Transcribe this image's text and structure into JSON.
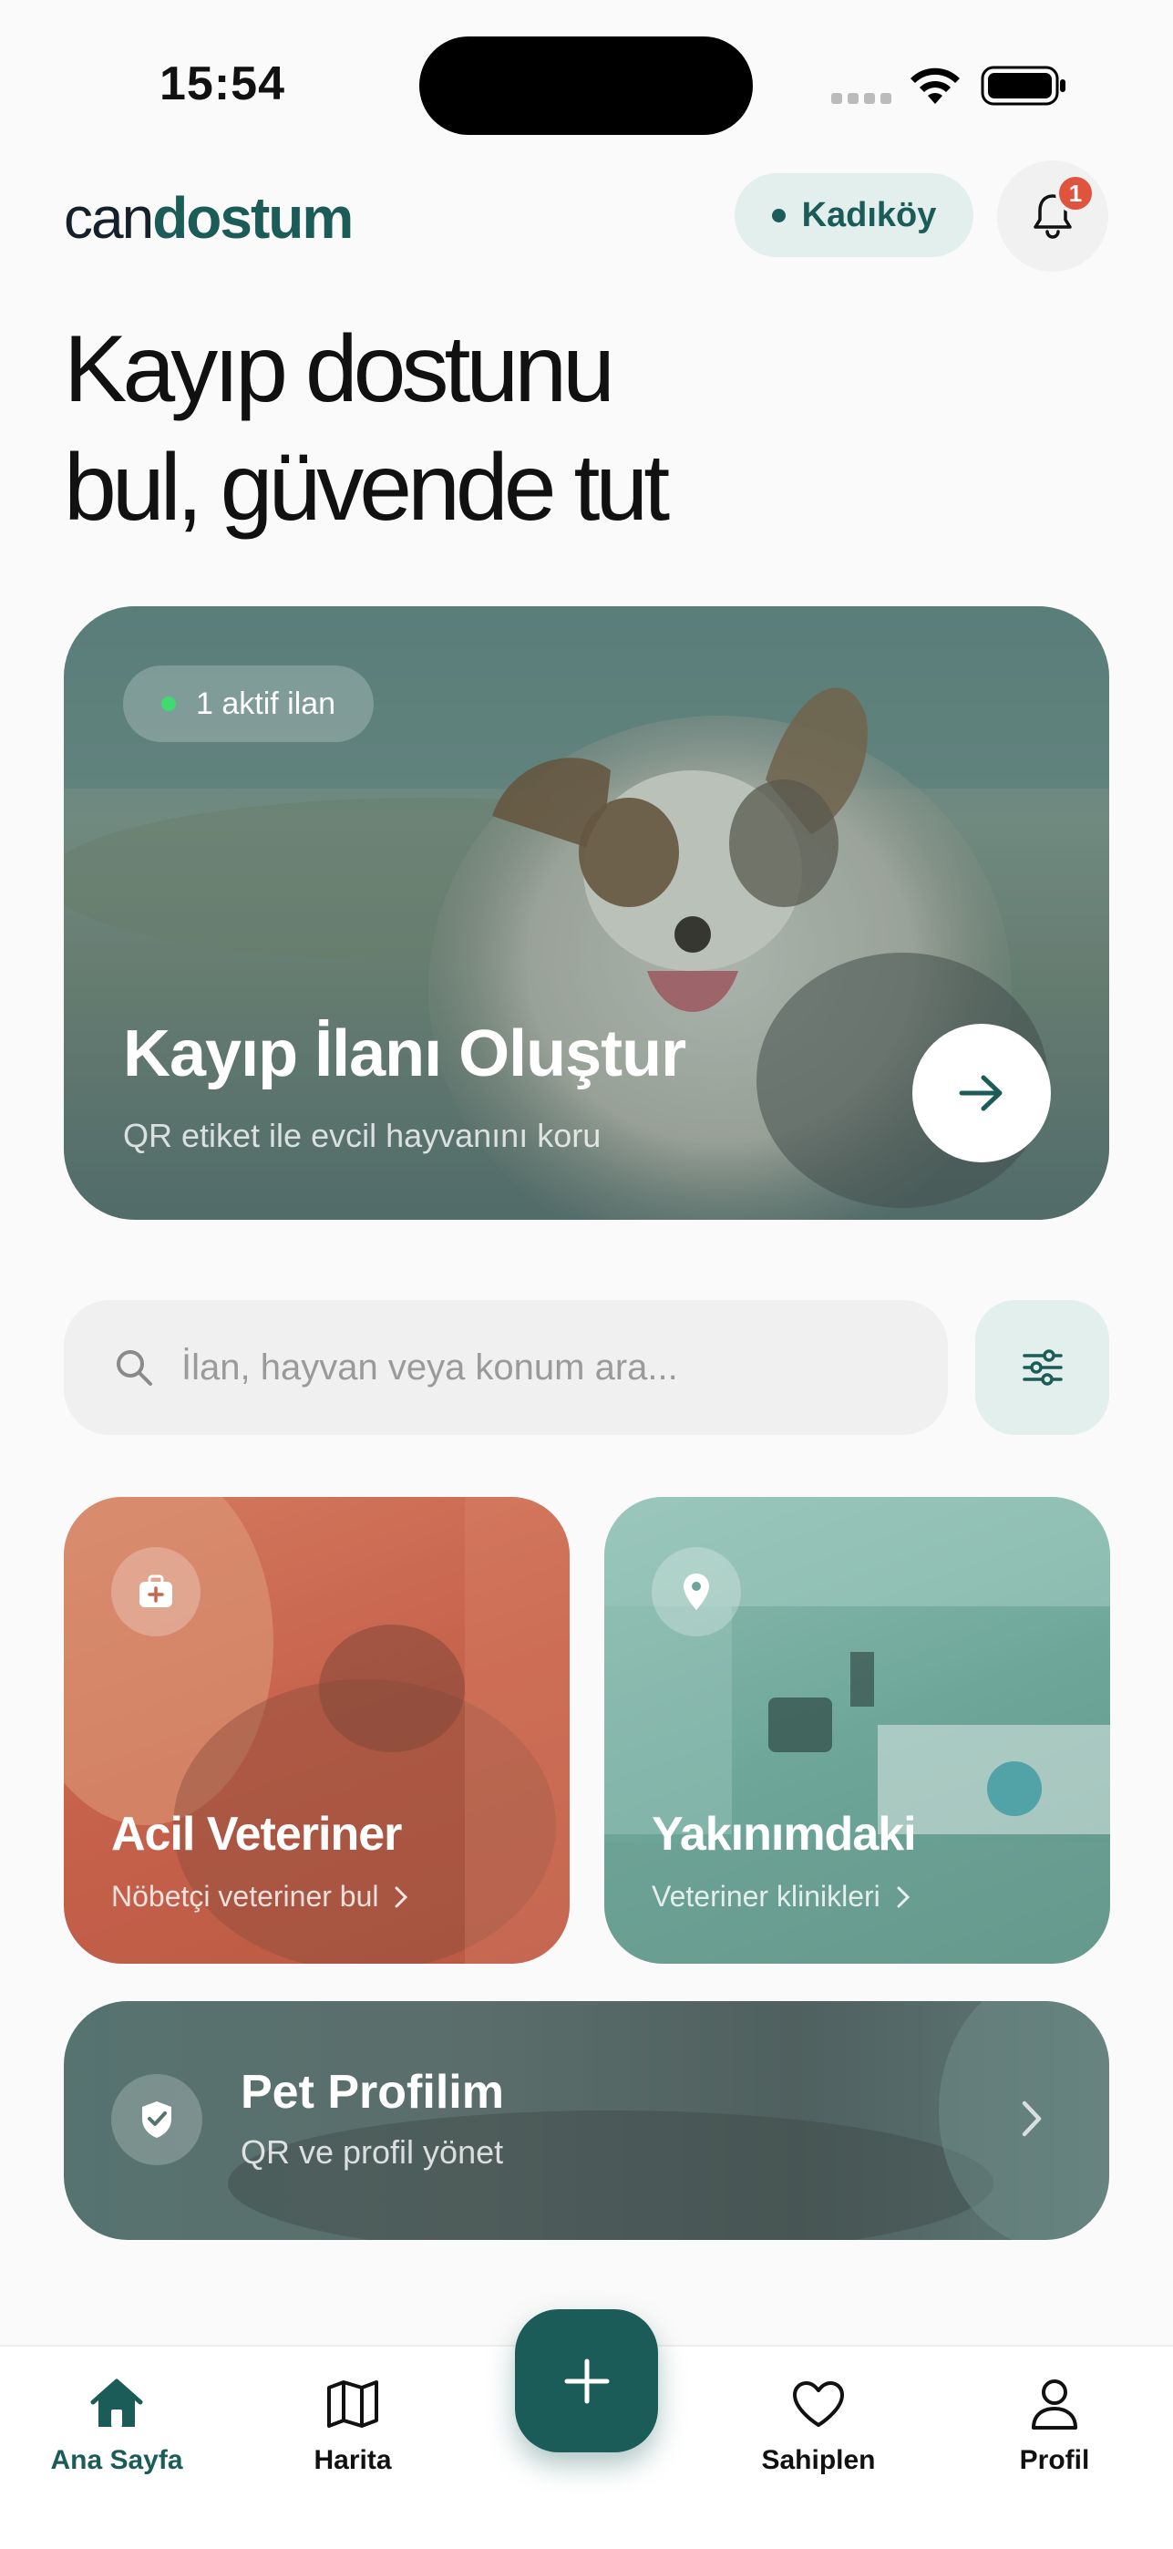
{
  "status_bar": {
    "time": "15:54"
  },
  "header": {
    "logo_light": "can",
    "logo_bold": "dostum",
    "location": "Kadıköy",
    "notification_count": "1"
  },
  "hero": {
    "title_line1": "Kayıp dostunu",
    "title_line2": "bul, güvende tut"
  },
  "lost_card": {
    "active_label": "1 aktif ilan",
    "title": "Kayıp İlanı Oluştur",
    "subtitle": "QR etiket ile evcil hayvanını koru"
  },
  "search": {
    "placeholder": "İlan, hayvan veya konum ara..."
  },
  "tiles": [
    {
      "title": "Acil Veteriner",
      "subtitle": "Nöbetçi veteriner bul",
      "icon": "first-aid-kit-icon"
    },
    {
      "title": "Yakınımdaki",
      "subtitle": "Veteriner klinikleri",
      "icon": "map-pin-icon"
    }
  ],
  "pet_profile": {
    "title": "Pet Profilim",
    "subtitle": "QR ve profil yönet",
    "icon": "shield-check-icon"
  },
  "tabbar": {
    "items": [
      {
        "label": "Ana Sayfa",
        "icon": "home-icon",
        "active": true
      },
      {
        "label": "Harita",
        "icon": "map-icon",
        "active": false
      },
      {
        "label": "Sahiplen",
        "icon": "heart-icon",
        "active": false
      },
      {
        "label": "Profil",
        "icon": "user-icon",
        "active": false
      }
    ],
    "fab_icon": "plus-icon"
  },
  "colors": {
    "brand": "#1c5c58",
    "brand_light": "#e3efed",
    "badge": "#e0533d",
    "active_dot": "#3fdb6f",
    "vet_tile": "#c76550",
    "near_tile": "#6ea79a"
  }
}
